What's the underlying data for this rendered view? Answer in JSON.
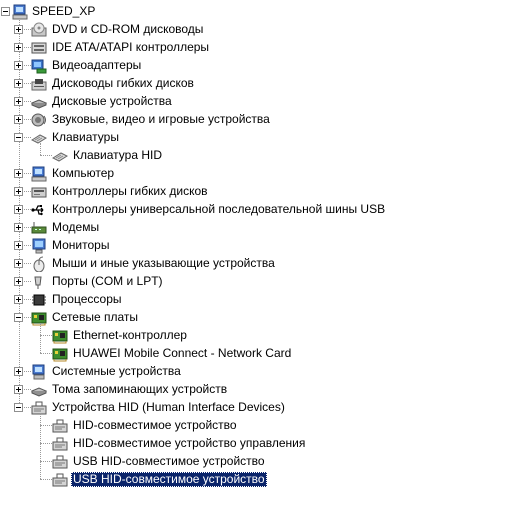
{
  "root": {
    "label": "SPEED_XP",
    "icon": "computer-icon"
  },
  "categories": [
    {
      "label": "DVD и CD-ROM дисководы",
      "icon": "cdrom-icon",
      "expanded": false,
      "children": []
    },
    {
      "label": "IDE ATA/ATAPI контроллеры",
      "icon": "ide-controller-icon",
      "expanded": false,
      "children": []
    },
    {
      "label": "Видеоадаптеры",
      "icon": "display-adapter-icon",
      "expanded": false,
      "children": []
    },
    {
      "label": "Дисководы гибких дисков",
      "icon": "floppy-drive-icon",
      "expanded": false,
      "children": []
    },
    {
      "label": "Дисковые устройства",
      "icon": "disk-drive-icon",
      "expanded": false,
      "children": []
    },
    {
      "label": "Звуковые, видео и игровые устройства",
      "icon": "sound-icon",
      "expanded": false,
      "children": []
    },
    {
      "label": "Клавиатуры",
      "icon": "keyboard-icon",
      "expanded": true,
      "children": [
        {
          "label": "Клавиатура HID",
          "icon": "keyboard-icon",
          "selected": false
        }
      ]
    },
    {
      "label": "Компьютер",
      "icon": "computer-icon",
      "expanded": false,
      "children": []
    },
    {
      "label": "Контроллеры гибких дисков",
      "icon": "floppy-controller-icon",
      "expanded": false,
      "children": []
    },
    {
      "label": "Контроллеры универсальной последовательной шины USB",
      "icon": "usb-icon",
      "expanded": false,
      "children": []
    },
    {
      "label": "Модемы",
      "icon": "modem-icon",
      "expanded": false,
      "children": []
    },
    {
      "label": "Мониторы",
      "icon": "monitor-icon",
      "expanded": false,
      "children": []
    },
    {
      "label": "Мыши и иные указывающие устройства",
      "icon": "mouse-icon",
      "expanded": false,
      "children": []
    },
    {
      "label": "Порты (COM и LPT)",
      "icon": "port-icon",
      "expanded": false,
      "children": []
    },
    {
      "label": "Процессоры",
      "icon": "processor-icon",
      "expanded": false,
      "children": []
    },
    {
      "label": "Сетевые платы",
      "icon": "network-card-icon",
      "expanded": true,
      "children": [
        {
          "label": "Ethernet-контроллер",
          "icon": "network-card-icon",
          "selected": false
        },
        {
          "label": "HUAWEI Mobile Connect - Network Card",
          "icon": "network-card-icon",
          "selected": false
        }
      ]
    },
    {
      "label": "Системные устройства",
      "icon": "system-device-icon",
      "expanded": false,
      "children": []
    },
    {
      "label": "Тома запоминающих устройств",
      "icon": "storage-volume-icon",
      "expanded": false,
      "children": []
    },
    {
      "label": "Устройства HID (Human Interface Devices)",
      "icon": "hid-icon",
      "expanded": true,
      "children": [
        {
          "label": "HID-совместимое устройство",
          "icon": "hid-icon",
          "selected": false
        },
        {
          "label": "HID-совместимое устройство управления",
          "icon": "hid-icon",
          "selected": false
        },
        {
          "label": "USB HID-совместимое устройство",
          "icon": "hid-icon",
          "selected": false
        },
        {
          "label": "USB HID-совместимое устройство",
          "icon": "hid-icon",
          "selected": true
        }
      ]
    }
  ],
  "colors": {
    "selection_bg": "#0a246a",
    "selection_text": "#ffffff",
    "tree_lines": "#9a9a9a"
  }
}
